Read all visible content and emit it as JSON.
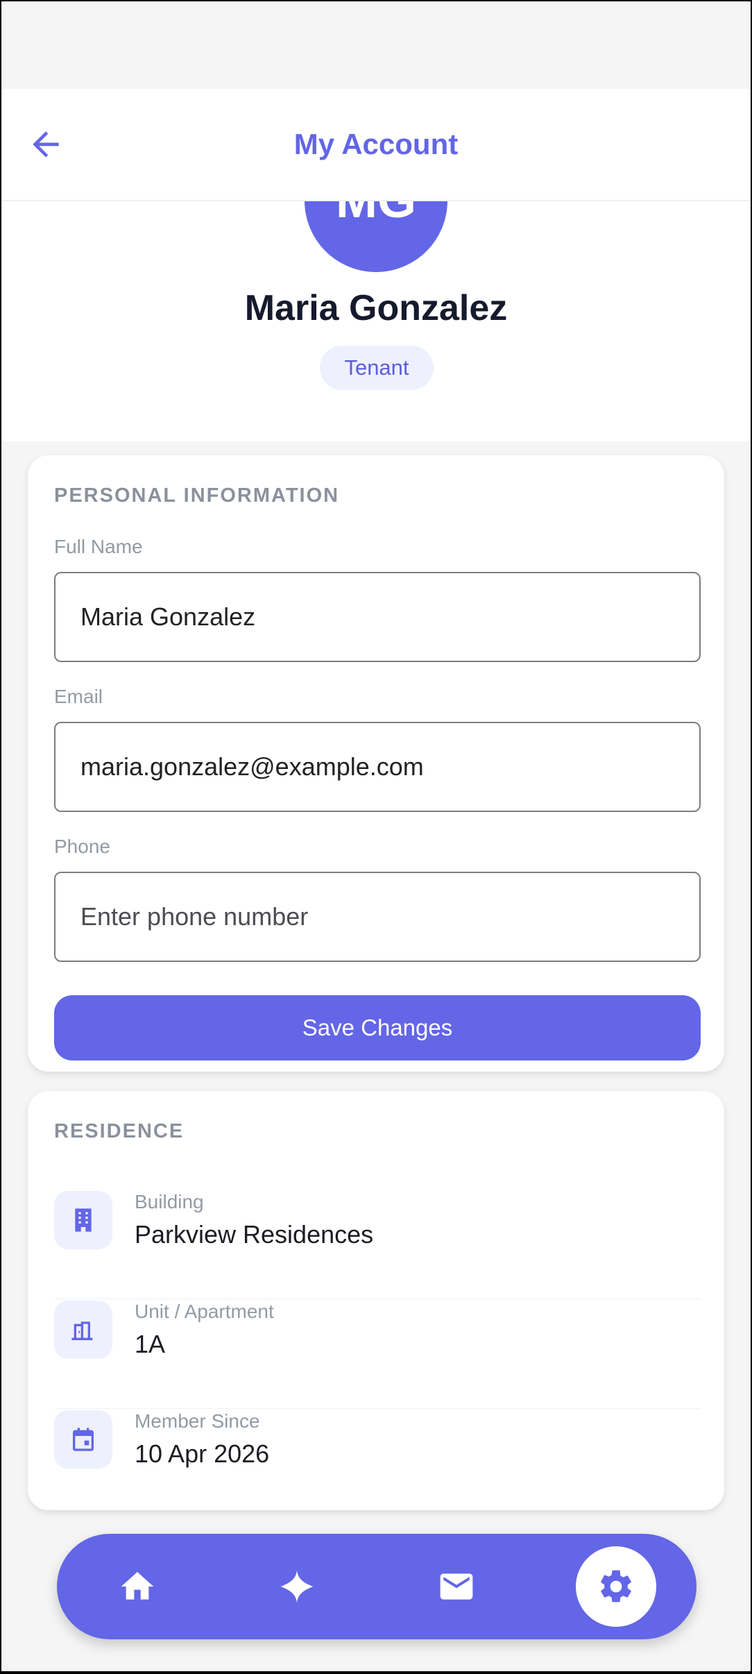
{
  "header": {
    "title": "My Account"
  },
  "profile": {
    "initials": "MG",
    "name": "Maria Gonzalez",
    "role": "Tenant"
  },
  "personal": {
    "section_title": "PERSONAL INFORMATION",
    "full_name_label": "Full Name",
    "full_name_value": "Maria Gonzalez",
    "email_label": "Email",
    "email_value": "maria.gonzalez@example.com",
    "phone_label": "Phone",
    "phone_placeholder": "Enter phone number",
    "save_label": "Save Changes"
  },
  "residence": {
    "section_title": "RESIDENCE",
    "rows": [
      {
        "label": "Building",
        "value": "Parkview Residences",
        "icon": "building-icon"
      },
      {
        "label": "Unit / Apartment",
        "value": "1A",
        "icon": "door-icon"
      },
      {
        "label": "Member Since",
        "value": "10 Apr 2026",
        "icon": "calendar-icon"
      }
    ]
  },
  "nav": {
    "items": [
      "home-icon",
      "sparkle-icon",
      "mail-icon",
      "gear-icon"
    ],
    "active": "gear-icon"
  },
  "colors": {
    "accent": "#6366e6",
    "accent_light": "#eef0fd",
    "text_dark": "#151a2d",
    "muted": "#939aa3"
  }
}
